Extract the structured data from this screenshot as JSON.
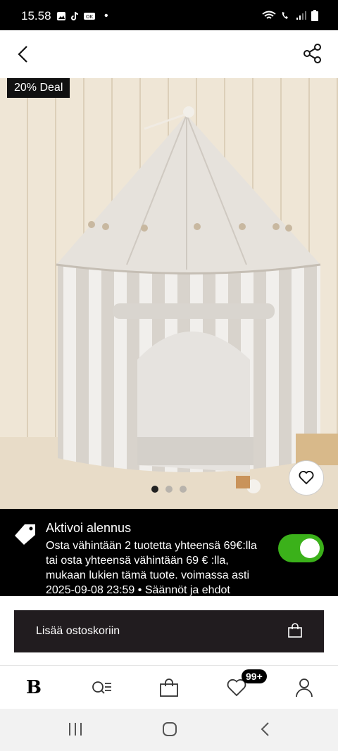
{
  "status": {
    "time": "15.58",
    "dot": "•"
  },
  "header": {
    "back_icon": "chevron-left-icon",
    "share_icon": "share-icon"
  },
  "product": {
    "deal_badge": "20% Deal",
    "image_desc_dots": 3,
    "active_dot": 0
  },
  "promo": {
    "title": "Aktivoi alennus",
    "text": "Osta vähintään 2 tuotetta yhteensä 69€:lla tai osta yhteensä vähintään 69 € :lla, mukaan lukien tämä tuote. voimassa asti 2025-09-08 23:59 • Säännöt ja ehdot",
    "toggle_on": true,
    "toggle_color": "#3bb11a"
  },
  "cart": {
    "label": "Lisää ostoskoriin"
  },
  "bottom_nav": {
    "logo": "B",
    "favorites_badge": "99+"
  },
  "colors": {
    "cart_bg": "#211c1f",
    "promo_bg": "#000000"
  }
}
